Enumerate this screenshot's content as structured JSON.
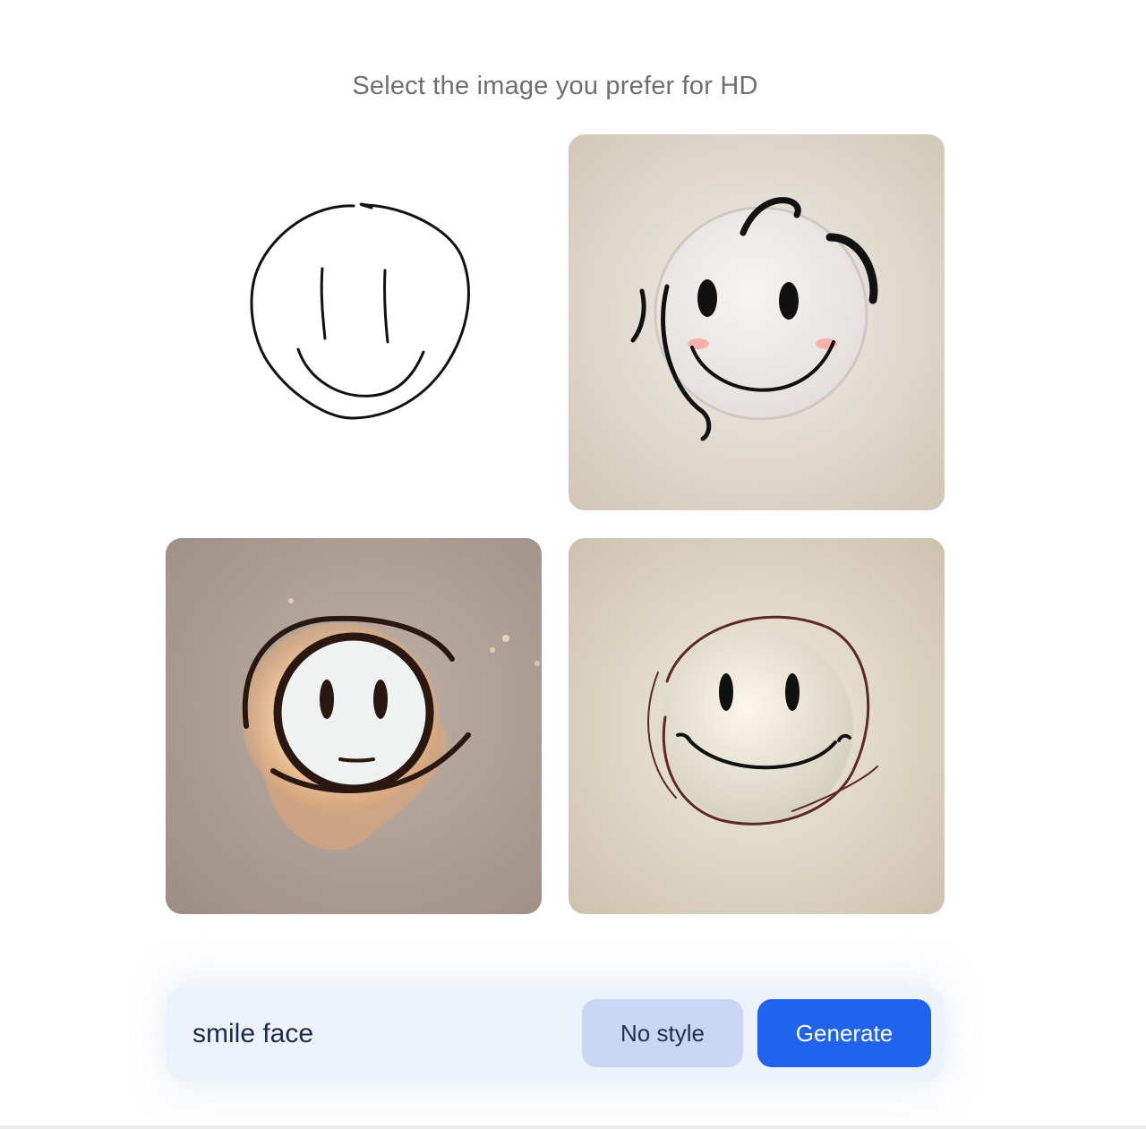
{
  "heading": "Select the image you prefer for HD",
  "images": [
    {
      "kind": "sketch"
    },
    {
      "kind": "generated"
    },
    {
      "kind": "generated"
    },
    {
      "kind": "generated"
    }
  ],
  "prompt": {
    "value": "smile face"
  },
  "buttons": {
    "style_label": "No style",
    "generate_label": "Generate"
  },
  "colors": {
    "heading": "#6f6f6f",
    "prompt_bar_bg": "#edf2fb",
    "style_button_bg": "#c9d7f3",
    "generate_button_bg": "#1f63ee",
    "generate_button_text": "#ffffff"
  }
}
